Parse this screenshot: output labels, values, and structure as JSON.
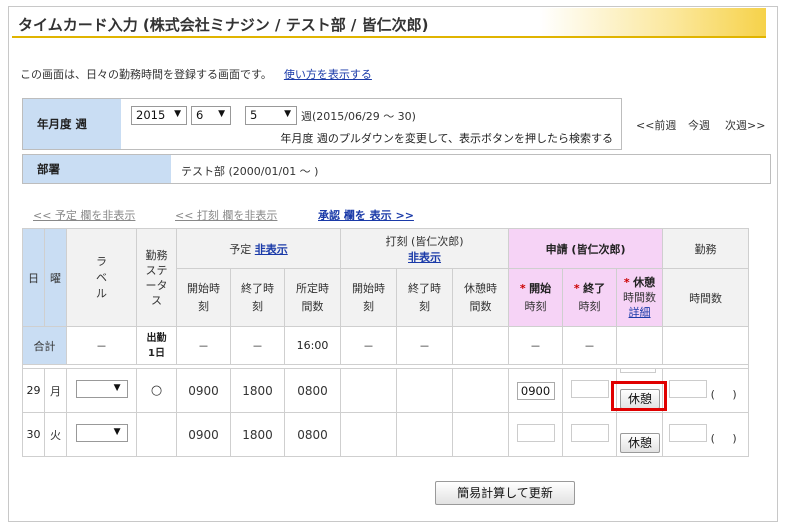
{
  "title": "タイムカード入力 (株式会社ミナジン / テスト部 / 皆仁次郎)",
  "intro": {
    "text": "この画面は、日々の勤務時間を登録する画面です。",
    "help_link": "使い方を表示する"
  },
  "period": {
    "label": "年月度 週",
    "year": "2015",
    "month": "6",
    "week": "5",
    "week_suffix": "週(2015/06/29 ～ 30)",
    "hint": "年月度 週のプルダウンを変更して、表示ボタンを押したら検索する",
    "nav_prev": "<<前週",
    "nav_this": "今週",
    "nav_next": "次週>>"
  },
  "department": {
    "label": "部署",
    "value": "テスト部 (2000/01/01 ～ )"
  },
  "toggles": {
    "schedule": "<< 予定 欄を非表示",
    "stamp": "<< 打刻 欄を非表示",
    "approval": "承認 欄を 表示 >>"
  },
  "table": {
    "headers": {
      "day": "日",
      "weekday": "曜",
      "label": "ラベル",
      "status": "勤務ステータス",
      "schedule": "予定",
      "schedule_toggle": "非表示",
      "stamp": "打刻 (皆仁次郎)",
      "stamp_toggle": "非表示",
      "request": "申請 (皆仁次郎)",
      "work": "勤務",
      "start": "開始時刻",
      "end": "終了時刻",
      "planned_hours": "所定時間数",
      "rest_hours": "休憩時間数",
      "req_start": "開始",
      "req_end": "終了",
      "req_rest": "休憩",
      "time_suffix": "時刻",
      "hours_suffix": "時間数",
      "detail": "詳細",
      "work_hours": "時間数",
      "required_mark": "*"
    },
    "totals": {
      "label": "合計",
      "dash": "－",
      "status_top": "出勤",
      "status_bottom": "1日",
      "planned": "16:00"
    },
    "rows": [
      {
        "day": "29",
        "weekday": "月",
        "status": "○",
        "start": "0900",
        "end": "1800",
        "planned": "0800",
        "req_start": "0900",
        "rest_button": "休憩"
      },
      {
        "day": "30",
        "weekday": "火",
        "status": "",
        "start": "0900",
        "end": "1800",
        "planned": "0800",
        "req_start": "",
        "rest_button": "休憩"
      }
    ],
    "paren_open": "(",
    "paren_close": ")"
  },
  "submit": "簡易計算して更新",
  "colors": {
    "accent_blue": "#c9ddf3",
    "request_pink": "#f6d3f6",
    "highlight": "#e00000",
    "title_gold": "#f6d24a"
  }
}
